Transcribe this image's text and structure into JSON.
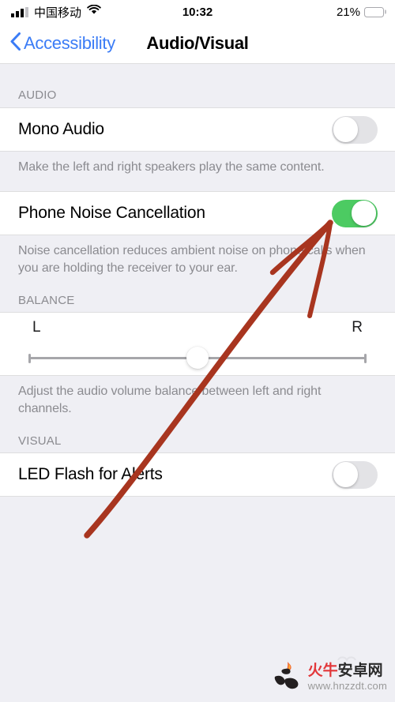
{
  "status_bar": {
    "carrier": "中国移动",
    "time": "10:32",
    "battery_percent": "21%",
    "battery_level": 21,
    "signal_icon": "cellular-signal-icon",
    "wifi_icon": "wifi-icon",
    "battery_icon": "battery-icon",
    "battery_color": "#f6cf45"
  },
  "nav": {
    "back_label": "Accessibility",
    "back_icon": "chevron-left-icon",
    "title": "Audio/Visual",
    "tint_color": "#3b7cf6"
  },
  "sections": {
    "audio": {
      "header": "AUDIO",
      "mono_audio": {
        "label": "Mono Audio",
        "toggle_state": "off",
        "footer": "Make the left and right speakers play the same content."
      },
      "noise_cancellation": {
        "label": "Phone Noise Cancellation",
        "toggle_state": "on",
        "toggle_color": "#4ccb62",
        "footer": "Noise cancellation reduces ambient noise on phone calls when you are holding the receiver to your ear."
      }
    },
    "balance": {
      "header": "BALANCE",
      "left_label": "L",
      "right_label": "R",
      "slider_value": 50,
      "footer": "Adjust the audio volume balance between left and right channels."
    },
    "visual": {
      "header": "VISUAL",
      "led_flash": {
        "label": "LED Flash for Alerts",
        "toggle_state": "off"
      }
    }
  },
  "annotation": {
    "color": "#a8351f",
    "shape": "arrow-pointing-to-noise-cancellation-toggle"
  },
  "watermark": {
    "title_red": "火牛",
    "title_dark": "安卓网",
    "url": "www.hnzzdt.com",
    "logo_icon": "bull-flame-logo-icon"
  }
}
